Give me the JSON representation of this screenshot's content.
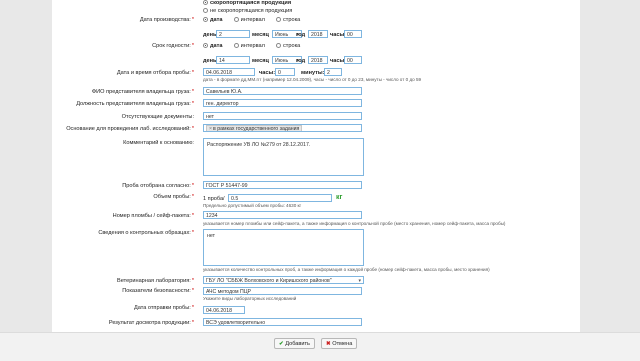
{
  "spoilage": {
    "options": [
      "скоропортящаяся продукция",
      "не скоропортящаяся продукция"
    ]
  },
  "production_date": {
    "label": "Дата производства:",
    "options": [
      "дата",
      "интервал",
      "строка"
    ],
    "day_label": "день",
    "day": "2",
    "month_label": "месяц",
    "month": "Июнь",
    "year_label": "год",
    "year": "2018",
    "hours_label": "часы",
    "hours": "00"
  },
  "shelf_life": {
    "label": "Срок годности:",
    "options": [
      "дата",
      "интервал",
      "строка"
    ],
    "day_label": "день",
    "day": "14",
    "month_label": "месяц",
    "month": "Июнь",
    "year_label": "год",
    "year": "2018",
    "hours_label": "часы",
    "hours": "00"
  },
  "sampling": {
    "label": "Дата и время отбора пробы:",
    "date": "04.06.2018",
    "hours_label": "часы:",
    "hours": "0",
    "minutes_label": "минуты:",
    "minutes": "2",
    "hint": "дата - в формате дд.ММ.ггг (например 12.04.2009), часы - число от 0 до 23, минуты - число от 0 до 59"
  },
  "owner_name": {
    "label": "ФИО представителя владельца груза:",
    "value": "Савельев Ю.А."
  },
  "owner_position": {
    "label": "Должность представителя владельца груза:",
    "value": "ген. директор"
  },
  "missing_docs": {
    "label": "Отсутствующие документы:",
    "value": "нет"
  },
  "basis": {
    "label": "Основание для проведения лаб. исследований:",
    "chip": "в рамках государственного задания",
    "chip_close": "×"
  },
  "basis_comment": {
    "label": "Комментарий к основанию:",
    "value": "Распоряжение УВ ЛО №279 от 28.12.2017."
  },
  "sampled_per": {
    "label": "Проба отобрана согласно:",
    "value": "ГОСТ Р 51447-99"
  },
  "sample_volume": {
    "label": "Объем пробы:",
    "count": "1 проба",
    "sep": "/",
    "amount": "0.5",
    "unit": "кг",
    "hint": "Предельно допустимый объем пробы: 4630 кг"
  },
  "seal_number": {
    "label": "Номер пломбы / сейф-пакета:",
    "value": "1234",
    "hint": "указывается номер пломбы или сейф-пакета, а также информация о контрольной пробе (место хранения, номер сейф-пакета, масса пробы)"
  },
  "control_samples": {
    "label": "Сведения о контрольных образцах:",
    "value": "нет",
    "hint": "указывается количество контрольных проб, а также информация о каждой пробе (номер сейф-пакета, масса пробы, место хранения)"
  },
  "vet_lab": {
    "label": "Ветеринарная лаборатория:",
    "value": "ГБУ ЛО \"СББЖ Волховского и Киришского районов\""
  },
  "safety": {
    "label": "Показатели безопасности:",
    "value": "АЧС методом ПЦР",
    "hint": "Укажите виды лабораторных исследований"
  },
  "send_date": {
    "label": "Дата отправки пробы:",
    "value": "04.06.2018"
  },
  "inspection": {
    "label": "Результат досмотра продукции:",
    "value": "ВСЭ удовлетворительно"
  },
  "buttons": {
    "add": "Добавить",
    "cancel": "Отмена"
  },
  "colors": {
    "accent_border": "#7fb6e0",
    "add_icon": "#2e9e2e",
    "cancel_icon": "#cc2222",
    "unit_green": "#2e9e2e"
  }
}
